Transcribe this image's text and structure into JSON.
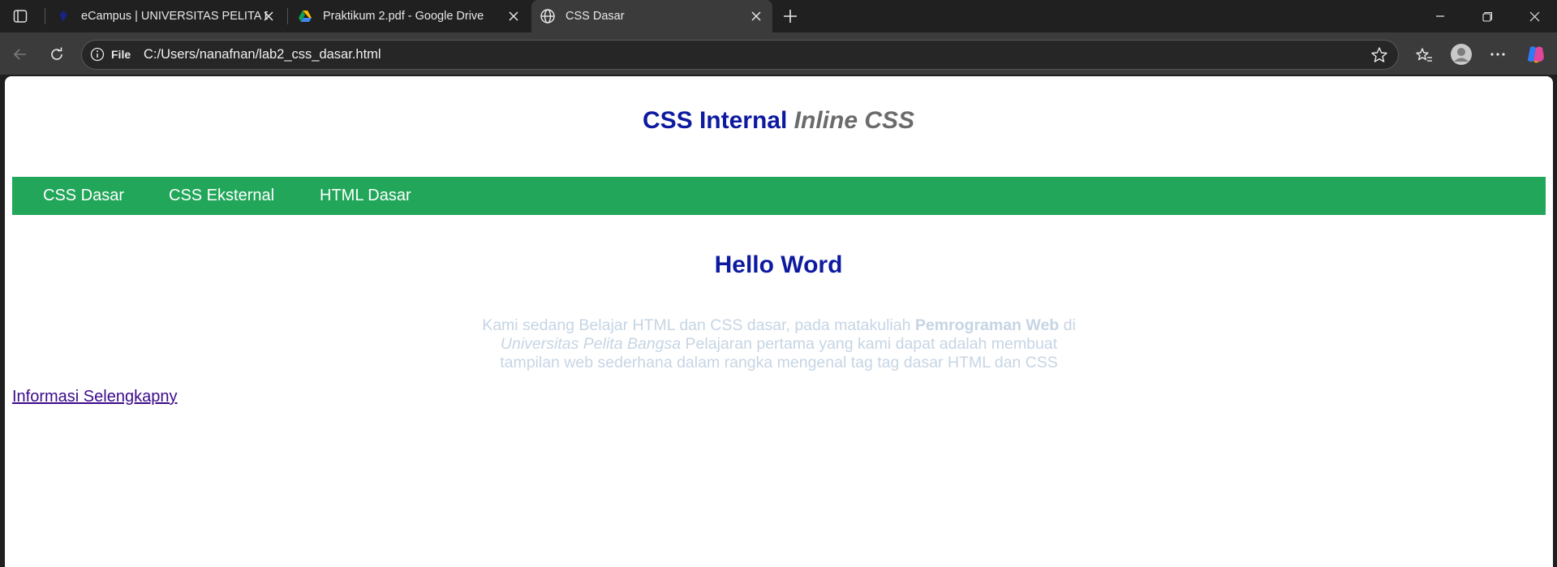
{
  "browser": {
    "tabs": [
      {
        "title": "eCampus | UNIVERSITAS PELITA B",
        "favicon": "ecampus-icon"
      },
      {
        "title": "Praktikum 2.pdf - Google Drive",
        "favicon": "google-drive-icon"
      },
      {
        "title": "CSS Dasar",
        "favicon": "globe-icon",
        "active": true
      }
    ],
    "address": {
      "scheme_label": "File",
      "url": "C:/Users/nanafnan/lab2_css_dasar.html"
    }
  },
  "page": {
    "heading": {
      "part1": "CSS Internal",
      "part2": "Inline",
      "part3": "CSS"
    },
    "nav": [
      "CSS Dasar",
      "CSS Eksternal",
      "HTML Dasar"
    ],
    "subheading": "Hello Word",
    "paragraph": {
      "t1": "Kami sedang Belajar HTML dan CSS dasar, pada matakuliah ",
      "b1": "Pemrograman Web",
      "t2": " di ",
      "i1": "Universitas Pelita Bangsa",
      "t3": " Pelajaran pertama yang kami dapat adalah membuat tampilan web sederhana dalam rangka mengenal tag tag dasar HTML dan CSS"
    },
    "link": "Informasi Selengkapny"
  },
  "colors": {
    "heading": "#0d1aa0",
    "nav_bg": "#21a65a",
    "paragraph": "#c6d5e4",
    "link": "#3b0a8a"
  }
}
